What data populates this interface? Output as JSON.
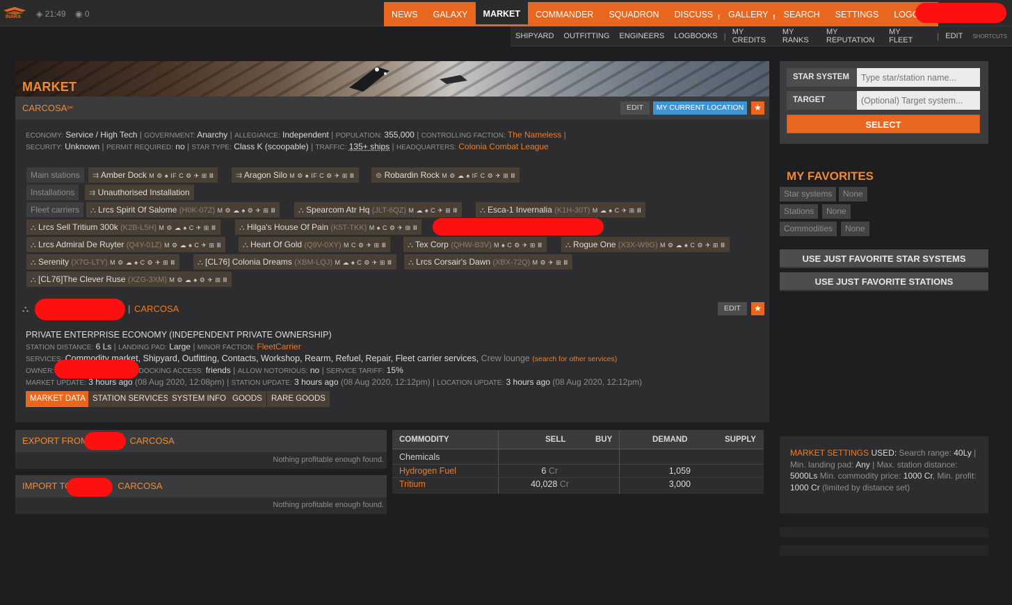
{
  "topbar": {
    "logo_text": "INARA",
    "time": "21:49",
    "count": "0",
    "nav": [
      {
        "label": "NEWS",
        "excl": ""
      },
      {
        "label": "GALAXY",
        "excl": ""
      },
      {
        "label": "MARKET",
        "excl": ""
      },
      {
        "label": "COMMANDER",
        "excl": ""
      },
      {
        "label": "SQUADRON",
        "excl": ""
      },
      {
        "label": "DISCUSS",
        "excl": "!"
      },
      {
        "label": "GALLERY",
        "excl": "!"
      },
      {
        "label": "SEARCH",
        "excl": ""
      },
      {
        "label": "SETTINGS",
        "excl": ""
      },
      {
        "label": "LOGOUT",
        "excl": ""
      }
    ],
    "subnav": [
      "SHIPYARD",
      "OUTFITTING",
      "ENGINEERS",
      "LOGBOOKS",
      "MY CREDITS",
      "MY RANKS",
      "MY REPUTATION",
      "MY FLEET"
    ],
    "edit": "EDIT",
    "shortcuts": "SHORTCUTS"
  },
  "panel": {
    "title": "MARKET",
    "system": "CARCOSA",
    "edit_label": "EDIT",
    "current_location_label": "MY CURRENT LOCATION",
    "star": "★",
    "info1": {
      "economy_lbl": "ECONOMY:",
      "economy": "Service / High Tech",
      "government_lbl": "GOVERNMENT:",
      "government": "Anarchy",
      "allegiance_lbl": "ALLEGIANCE:",
      "allegiance": "Independent",
      "population_lbl": "POPULATION:",
      "population": "355,000",
      "faction_lbl": "CONTROLLING FACTION:",
      "faction": "The Nameless"
    },
    "info2": {
      "security_lbl": "SECURITY:",
      "security": "Unknown",
      "permit_lbl": "PERMIT REQUIRED:",
      "permit": "no",
      "startype_lbl": "STAR TYPE:",
      "startype": "Class K (scoopable)",
      "traffic_lbl": "TRAFFIC:",
      "traffic": "135+ ships",
      "hq_lbl": "HEADQUARTERS:",
      "hq": "Colonia Combat League"
    },
    "station_groups": {
      "main": "Main stations",
      "installations": "Installations",
      "fleet": "Fleet carriers"
    },
    "main_stations": [
      {
        "name": "Amber Dock",
        "code": "",
        "icons": "M ⚙ ♠ IF C ⚙ ✈ ⊞ Ⅲ"
      },
      {
        "name": "Aragon Silo",
        "code": "",
        "icons": "M ⚙ ♠ IF C ⚙ ✈ ⊞ Ⅲ"
      },
      {
        "name": "Robardin Rock",
        "code": "",
        "icons": "M ⚙ ☁ ♠ IF C ⚙ ✈ ⊞ Ⅲ"
      }
    ],
    "installations": [
      {
        "name": "Unauthorised Installation"
      }
    ],
    "fleet_carriers": [
      {
        "name": "Lrcs Spirit Of Salome",
        "code": "(H0K-07Z)",
        "icons": "M ⚙ ☁ ♠ ⚙ ✈ ⊞ Ⅲ"
      },
      {
        "name": "Spearcom Atr Hq",
        "code": "(JLT-6QZ)",
        "icons": "M ☁ ♠ C ✈ ⊞ Ⅲ"
      },
      {
        "name": "Esca-1 Invernalia",
        "code": "(K1H-30T)",
        "icons": "M ☁ ♠ C ✈ ⊞ Ⅲ"
      },
      {
        "name": "Lrcs Sell Tritium 300k",
        "code": "(K2B-L5H)",
        "icons": "M ⚙ ☁ ♠ C ✈ ⊞ Ⅲ"
      },
      {
        "name": "Hilga's House Of Pain",
        "code": "(K5T-TKK)",
        "icons": "M ♠ C ⚙ ✈ ⊞ Ⅲ"
      },
      {
        "name": "Lrcs Admiral De Ruyter",
        "code": "(Q4Y-01Z)",
        "icons": "M ⚙ ☁ ♠ C ✈ ⊞ Ⅲ"
      },
      {
        "name": "Heart Of Gold",
        "code": "(Q9V-0XY)",
        "icons": "M C ⚙ ✈ ⊞ Ⅲ"
      },
      {
        "name": "Tex Corp",
        "code": "(QHW-B3V)",
        "icons": "M ♠ C ⚙ ✈ ⊞ Ⅲ"
      },
      {
        "name": "Rogue One",
        "code": "(X3X-W9G)",
        "icons": "M ⚙ ☁ ♠ C ⚙ ✈ ⊞ Ⅲ"
      },
      {
        "name": "Serenity",
        "code": "(X7G-LTY)",
        "icons": "M ⚙ ☁ ♠ C ⚙ ✈ ⊞ Ⅲ"
      },
      {
        "name": "[CL76] Colonia Dreams",
        "code": "(XBM-LQJ)",
        "icons": "M ☁ ♠ C ⚙ ✈ ⊞ Ⅲ"
      },
      {
        "name": "Lrcs Corsair's Dawn",
        "code": "(XBX-72Q)",
        "icons": "M ⚙ ✈ ⊞ Ⅲ"
      },
      {
        "name": "[CL76]The Clever Ruse",
        "code": "(XZG-3XM)",
        "icons": "M ⚙ ☁ ♠ ⚙ ✈ ⊞ Ⅲ"
      }
    ],
    "station": {
      "system": "CARCOSA",
      "economy": "PRIVATE ENTERPRISE ECONOMY (INDEPENDENT PRIVATE OWNERSHIP)",
      "distance_lbl": "STATION DISTANCE:",
      "distance": "6 Ls",
      "pad_lbl": "LANDING PAD:",
      "pad": "Large",
      "minor_lbl": "MINOR FACTION:",
      "minor": "FleetCarrier",
      "services_lbl": "SERVICES:",
      "services": "Commodity market, Shipyard, Outfitting, Contacts, Workshop, Rearm, Refuel, Repair, Fleet carrier services,",
      "services_extra": "Crew lounge",
      "services_search": "(search for other services)",
      "owner_lbl": "OWNER:",
      "docking_lbl": "DOCKING ACCESS:",
      "docking": "friends",
      "notorious_lbl": "ALLOW NOTORIOUS:",
      "notorious": "no",
      "tariff_lbl": "SERVICE TARIFF:",
      "tariff": "15%",
      "market_upd_lbl": "MARKET UPDATE:",
      "market_upd": "3 hours ago",
      "market_upd_date": "(08 Aug 2020, 12:08pm)",
      "station_upd_lbl": "STATION UPDATE:",
      "station_upd": "3 hours ago",
      "station_upd_date": "(08 Aug 2020, 12:12pm)",
      "loc_upd_lbl": "LOCATION UPDATE:",
      "loc_upd": "3 hours ago",
      "loc_upd_date": "(08 Aug 2020, 12:12pm)"
    },
    "tabs": [
      "MARKET DATA",
      "STATION SERVICES",
      "SYSTEM INFO",
      "GOODS",
      "RARE GOODS"
    ]
  },
  "export": {
    "prefix": "EXPORT FROM",
    "system": "CARCOSA",
    "note": "Nothing profitable enough found."
  },
  "import": {
    "prefix": "IMPORT TO",
    "system": "CARCOSA",
    "note": "Nothing profitable enough found."
  },
  "commodities": {
    "headers": {
      "commodity": "COMMODITY",
      "sell": "SELL",
      "buy": "BUY",
      "demand": "DEMAND",
      "supply": "SUPPLY"
    },
    "category": "Chemicals",
    "rows": [
      {
        "name": "Hydrogen Fuel",
        "sell": "6",
        "unit": "Cr",
        "demand": "1,059"
      },
      {
        "name": "Tritium",
        "sell": "40,028",
        "unit": "Cr",
        "demand": "3,000"
      }
    ]
  },
  "sidebar": {
    "star_system_label": "STAR SYSTEM",
    "star_system_placeholder": "Type star/station name...",
    "target_label": "TARGET",
    "target_placeholder": "(Optional) Target system...",
    "select_label": "SELECT",
    "favorites_title": "MY FAVORITES",
    "fav_star_systems": "Star systems",
    "fav_star_systems_val": "None",
    "fav_stations": "Stations",
    "fav_stations_val": "None",
    "fav_commodities": "Commodities",
    "fav_commodities_val": "None",
    "btn_fav_systems": "USE JUST FAVORITE STAR SYSTEMS",
    "btn_fav_stations": "USE JUST FAVORITE STATIONS",
    "ms": {
      "title": "MARKET SETTINGS",
      "used": "USED:",
      "range_lbl": "Search range:",
      "range": "40Ly",
      "pad_lbl": "Min. landing pad:",
      "pad": "Any",
      "dist_lbl": "Max. station distance:",
      "dist": "5000Ls",
      "price_lbl": "Min. commodity price:",
      "price": "1000 Cr",
      "profit_lbl": "Min. profit:",
      "profit": "1000 Cr",
      "note": "(limited by distance set)"
    }
  },
  "colors": {
    "accent": "#e8661d",
    "blue": "#3f95d1",
    "redact": "#ff1010"
  }
}
